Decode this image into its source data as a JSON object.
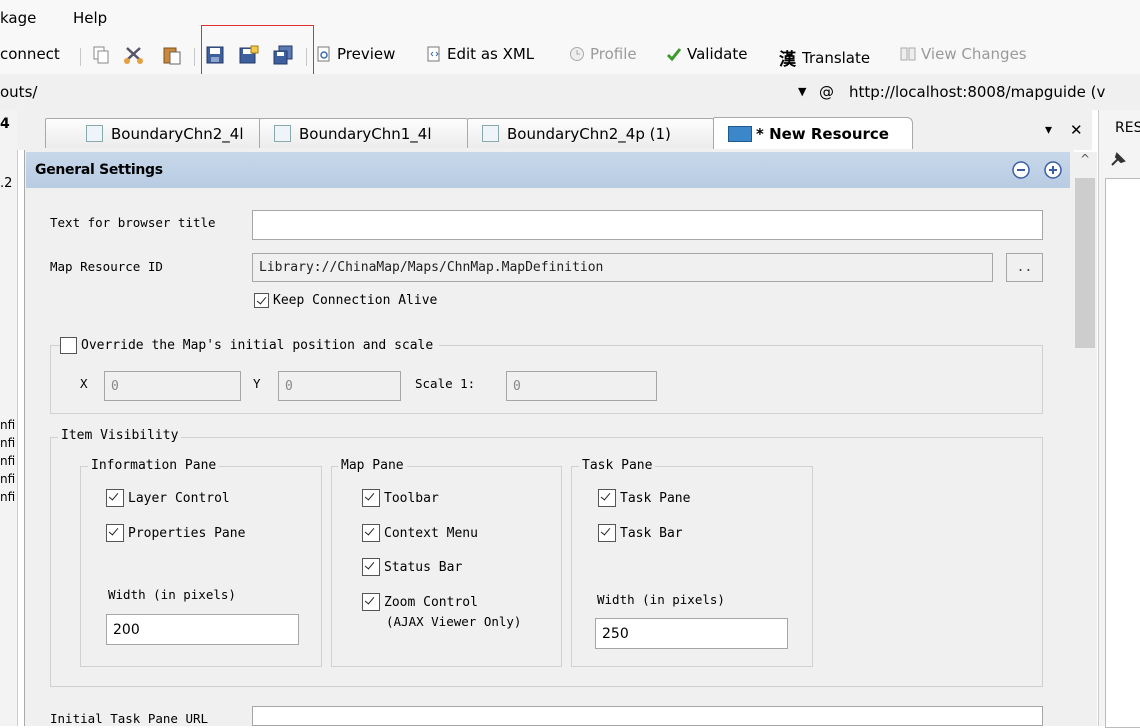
{
  "menu": {
    "package": "kage",
    "help": "Help"
  },
  "toolbar": {
    "connect": "connect",
    "preview": "Preview",
    "edit_xml": "Edit as XML",
    "profile": "Profile",
    "validate": "Validate",
    "translate_glyph": "漢",
    "translate": "Translate",
    "view_changes": "View Changes"
  },
  "address": {
    "path": "outs/",
    "at": "@",
    "url": "http://localhost:8008/mapguide (v"
  },
  "left_panel": {
    "items": [
      "4",
      ".2",
      "nfi",
      "nfi",
      "nfi",
      "nfi",
      "nfi"
    ]
  },
  "tabs": [
    {
      "label": "BoundaryChn2_4l"
    },
    {
      "label": "BoundaryChn1_4l"
    },
    {
      "label": "BoundaryChn2_4p (1)"
    },
    {
      "label": "* New Resource"
    }
  ],
  "tab_controls": {
    "menu": "▾",
    "close": "✕"
  },
  "right_panel": {
    "label": "RES"
  },
  "section": {
    "title": "General Settings"
  },
  "form": {
    "browser_title_label": "Text for browser title",
    "browser_title_value": "",
    "map_resource_label": "Map Resource ID",
    "map_resource_value": "Library://ChinaMap/Maps/ChnMap.MapDefinition",
    "browse_label": "..",
    "keep_alive": "Keep Connection Alive",
    "override_label": "Override the Map's initial position and scale",
    "x_label": "X",
    "x_value": "0",
    "y_label": "Y",
    "y_value": "0",
    "scale_label": "Scale 1:",
    "scale_value": "0",
    "item_visibility": "Item Visibility",
    "info_pane": "Information Pane",
    "layer_control": "Layer Control",
    "properties_pane": "Properties Pane",
    "info_width_label": "Width (in pixels)",
    "info_width_value": "200",
    "map_pane": "Map Pane",
    "toolbar": "Toolbar",
    "context_menu": "Context Menu",
    "status_bar": "Status Bar",
    "zoom_control": "Zoom Control",
    "zoom_note": "(AJAX Viewer Only)",
    "task_pane_group": "Task Pane",
    "task_pane": "Task Pane",
    "task_bar": "Task Bar",
    "task_width_label": "Width (in pixels)",
    "task_width_value": "250",
    "initial_task_url_label": "Initial Task Pane URL",
    "initial_task_url_value": ""
  },
  "colors": {
    "section_header": "#b7cbe2",
    "highlight": "#e03030",
    "validate_check": "#3a9a2a"
  }
}
